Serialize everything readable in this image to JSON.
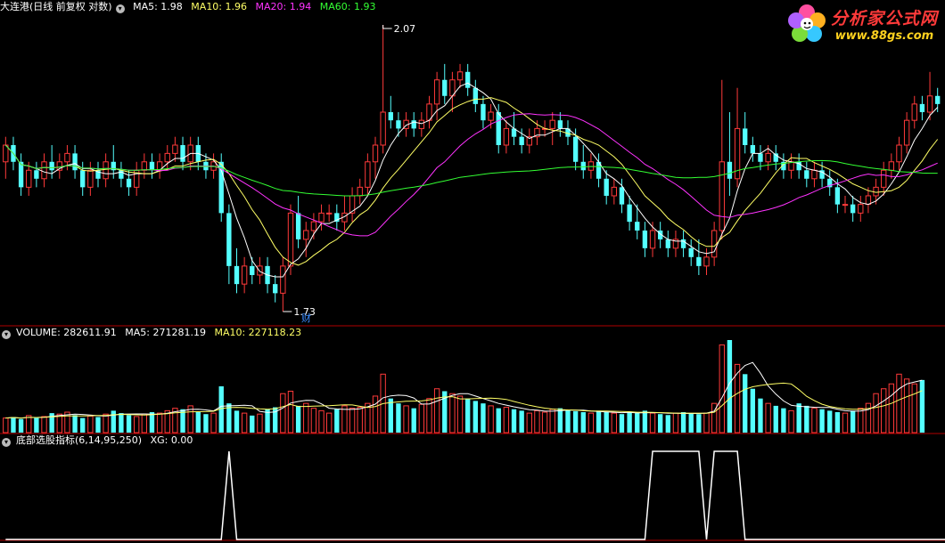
{
  "header_main": {
    "stock": "大连港(日线 前复权 对数)",
    "ma5": "MA5: 1.98",
    "ma10": "MA10: 1.96",
    "ma20": "MA20: 1.94",
    "ma60": "MA60: 1.93"
  },
  "header_volume": {
    "volume": "VOLUME: 282611.91",
    "ma5": "MA5: 271281.19",
    "ma10": "MA10: 227118.23"
  },
  "header_indicator": {
    "name": "底部选股指标(6,14,95,250)",
    "xg": "XG: 0.00"
  },
  "annotations": {
    "high_label": "2.07",
    "low_label": "1.73",
    "cai_label": "财"
  },
  "logo": {
    "line1": "分析家公式网",
    "line2": "www.88gs.com"
  },
  "colors": {
    "up": "#ff3a3a",
    "down": "#54ffff",
    "ma5": "#ffffff",
    "ma10": "#ffff66",
    "ma20": "#ff33ff",
    "ma60": "#33ff33",
    "separator": "#b00000"
  },
  "chart_data": {
    "type": "candlestick",
    "price_range": [
      1.73,
      2.07
    ],
    "candles_ohlc": [
      [
        1.9,
        1.93,
        1.88,
        1.92
      ],
      [
        1.92,
        1.93,
        1.89,
        1.9
      ],
      [
        1.9,
        1.91,
        1.86,
        1.87
      ],
      [
        1.87,
        1.9,
        1.86,
        1.89
      ],
      [
        1.89,
        1.9,
        1.87,
        1.88
      ],
      [
        1.88,
        1.91,
        1.87,
        1.9
      ],
      [
        1.9,
        1.92,
        1.88,
        1.89
      ],
      [
        1.89,
        1.91,
        1.88,
        1.9
      ],
      [
        1.9,
        1.92,
        1.89,
        1.91
      ],
      [
        1.91,
        1.92,
        1.88,
        1.89
      ],
      [
        1.89,
        1.9,
        1.86,
        1.87
      ],
      [
        1.87,
        1.9,
        1.86,
        1.89
      ],
      [
        1.89,
        1.9,
        1.87,
        1.88
      ],
      [
        1.88,
        1.91,
        1.87,
        1.9
      ],
      [
        1.9,
        1.92,
        1.88,
        1.89
      ],
      [
        1.89,
        1.9,
        1.87,
        1.88
      ],
      [
        1.88,
        1.89,
        1.86,
        1.87
      ],
      [
        1.87,
        1.9,
        1.86,
        1.89
      ],
      [
        1.89,
        1.91,
        1.88,
        1.9
      ],
      [
        1.9,
        1.91,
        1.88,
        1.89
      ],
      [
        1.89,
        1.91,
        1.88,
        1.9
      ],
      [
        1.9,
        1.92,
        1.89,
        1.91
      ],
      [
        1.91,
        1.93,
        1.9,
        1.92
      ],
      [
        1.92,
        1.93,
        1.89,
        1.9
      ],
      [
        1.9,
        1.93,
        1.89,
        1.92
      ],
      [
        1.92,
        1.93,
        1.89,
        1.9
      ],
      [
        1.9,
        1.91,
        1.88,
        1.89
      ],
      [
        1.89,
        1.91,
        1.88,
        1.9
      ],
      [
        1.9,
        1.91,
        1.83,
        1.84
      ],
      [
        1.84,
        1.85,
        1.76,
        1.78
      ],
      [
        1.78,
        1.8,
        1.75,
        1.76
      ],
      [
        1.76,
        1.79,
        1.75,
        1.78
      ],
      [
        1.78,
        1.79,
        1.76,
        1.77
      ],
      [
        1.77,
        1.79,
        1.76,
        1.78
      ],
      [
        1.78,
        1.79,
        1.75,
        1.76
      ],
      [
        1.76,
        1.77,
        1.74,
        1.75
      ],
      [
        1.75,
        1.79,
        1.73,
        1.78
      ],
      [
        1.78,
        1.85,
        1.77,
        1.84
      ],
      [
        1.84,
        1.86,
        1.8,
        1.81
      ],
      [
        1.81,
        1.83,
        1.79,
        1.82
      ],
      [
        1.82,
        1.84,
        1.81,
        1.83
      ],
      [
        1.83,
        1.85,
        1.82,
        1.84
      ],
      [
        1.84,
        1.85,
        1.83,
        1.84
      ],
      [
        1.84,
        1.85,
        1.82,
        1.83
      ],
      [
        1.83,
        1.86,
        1.82,
        1.84
      ],
      [
        1.84,
        1.87,
        1.83,
        1.86
      ],
      [
        1.86,
        1.88,
        1.85,
        1.87
      ],
      [
        1.87,
        1.91,
        1.86,
        1.9
      ],
      [
        1.9,
        1.93,
        1.88,
        1.92
      ],
      [
        1.92,
        2.07,
        1.91,
        1.96
      ],
      [
        1.96,
        1.98,
        1.94,
        1.95
      ],
      [
        1.95,
        1.96,
        1.93,
        1.94
      ],
      [
        1.94,
        1.96,
        1.93,
        1.95
      ],
      [
        1.95,
        1.96,
        1.93,
        1.94
      ],
      [
        1.94,
        1.96,
        1.93,
        1.95
      ],
      [
        1.95,
        1.98,
        1.94,
        1.97
      ],
      [
        1.97,
        2.01,
        1.95,
        2.0
      ],
      [
        2.0,
        2.02,
        1.97,
        1.98
      ],
      [
        1.98,
        2.01,
        1.96,
        2.0
      ],
      [
        2.0,
        2.02,
        1.99,
        2.01
      ],
      [
        2.01,
        2.02,
        1.98,
        1.99
      ],
      [
        1.99,
        2.0,
        1.96,
        1.97
      ],
      [
        1.97,
        1.98,
        1.94,
        1.95
      ],
      [
        1.95,
        1.97,
        1.94,
        1.96
      ],
      [
        1.96,
        1.97,
        1.91,
        1.92
      ],
      [
        1.92,
        1.95,
        1.91,
        1.94
      ],
      [
        1.94,
        1.96,
        1.92,
        1.93
      ],
      [
        1.93,
        1.94,
        1.91,
        1.92
      ],
      [
        1.92,
        1.94,
        1.91,
        1.93
      ],
      [
        1.93,
        1.95,
        1.92,
        1.94
      ],
      [
        1.94,
        1.95,
        1.93,
        1.94
      ],
      [
        1.94,
        1.96,
        1.92,
        1.95
      ],
      [
        1.95,
        1.96,
        1.93,
        1.94
      ],
      [
        1.94,
        1.95,
        1.92,
        1.93
      ],
      [
        1.93,
        1.94,
        1.89,
        1.9
      ],
      [
        1.9,
        1.92,
        1.88,
        1.89
      ],
      [
        1.89,
        1.91,
        1.88,
        1.9
      ],
      [
        1.9,
        1.91,
        1.87,
        1.88
      ],
      [
        1.88,
        1.89,
        1.85,
        1.86
      ],
      [
        1.86,
        1.88,
        1.85,
        1.87
      ],
      [
        1.87,
        1.88,
        1.84,
        1.85
      ],
      [
        1.85,
        1.86,
        1.82,
        1.83
      ],
      [
        1.83,
        1.85,
        1.81,
        1.82
      ],
      [
        1.82,
        1.83,
        1.79,
        1.8
      ],
      [
        1.8,
        1.83,
        1.79,
        1.82
      ],
      [
        1.82,
        1.83,
        1.8,
        1.81
      ],
      [
        1.81,
        1.82,
        1.79,
        1.8
      ],
      [
        1.8,
        1.82,
        1.79,
        1.81
      ],
      [
        1.81,
        1.82,
        1.79,
        1.8
      ],
      [
        1.8,
        1.81,
        1.78,
        1.79
      ],
      [
        1.79,
        1.81,
        1.77,
        1.78
      ],
      [
        1.78,
        1.8,
        1.77,
        1.79
      ],
      [
        1.79,
        1.83,
        1.78,
        1.82
      ],
      [
        1.82,
        2.0,
        1.81,
        1.9
      ],
      [
        1.9,
        1.96,
        1.86,
        1.88
      ],
      [
        1.88,
        1.99,
        1.87,
        1.94
      ],
      [
        1.94,
        1.96,
        1.91,
        1.92
      ],
      [
        1.92,
        1.93,
        1.9,
        1.91
      ],
      [
        1.91,
        1.92,
        1.89,
        1.9
      ],
      [
        1.9,
        1.92,
        1.89,
        1.91
      ],
      [
        1.91,
        1.92,
        1.89,
        1.9
      ],
      [
        1.9,
        1.91,
        1.88,
        1.89
      ],
      [
        1.89,
        1.91,
        1.88,
        1.9
      ],
      [
        1.9,
        1.91,
        1.88,
        1.89
      ],
      [
        1.89,
        1.9,
        1.87,
        1.88
      ],
      [
        1.88,
        1.9,
        1.87,
        1.89
      ],
      [
        1.89,
        1.9,
        1.87,
        1.88
      ],
      [
        1.88,
        1.89,
        1.86,
        1.87
      ],
      [
        1.87,
        1.88,
        1.84,
        1.85
      ],
      [
        1.85,
        1.86,
        1.84,
        1.85
      ],
      [
        1.85,
        1.86,
        1.83,
        1.84
      ],
      [
        1.84,
        1.86,
        1.83,
        1.85
      ],
      [
        1.85,
        1.87,
        1.84,
        1.86
      ],
      [
        1.86,
        1.88,
        1.85,
        1.87
      ],
      [
        1.87,
        1.9,
        1.86,
        1.89
      ],
      [
        1.89,
        1.91,
        1.88,
        1.9
      ],
      [
        1.9,
        1.93,
        1.89,
        1.92
      ],
      [
        1.92,
        1.96,
        1.91,
        1.95
      ],
      [
        1.95,
        1.98,
        1.94,
        1.97
      ],
      [
        1.97,
        1.98,
        1.95,
        1.96
      ],
      [
        1.96,
        2.01,
        1.95,
        1.98
      ],
      [
        1.98,
        1.99,
        1.96,
        1.97
      ]
    ],
    "volume_panel": {
      "values": [
        30,
        32,
        28,
        35,
        30,
        33,
        40,
        38,
        42,
        36,
        30,
        34,
        32,
        38,
        45,
        40,
        36,
        33,
        38,
        42,
        40,
        45,
        50,
        48,
        55,
        42,
        38,
        40,
        95,
        60,
        45,
        40,
        35,
        38,
        48,
        52,
        80,
        85,
        55,
        60,
        50,
        45,
        40,
        48,
        55,
        50,
        52,
        60,
        75,
        120,
        70,
        60,
        55,
        50,
        58,
        70,
        90,
        85,
        80,
        75,
        70,
        65,
        60,
        55,
        50,
        52,
        48,
        45,
        40,
        45,
        42,
        48,
        50,
        46,
        44,
        42,
        40,
        45,
        42,
        40,
        38,
        42,
        40,
        45,
        40,
        38,
        36,
        40,
        42,
        40,
        38,
        40,
        60,
        180,
        190,
        140,
        120,
        90,
        70,
        60,
        55,
        50,
        45,
        60,
        55,
        50,
        48,
        45,
        42,
        40,
        45,
        50,
        60,
        80,
        90,
        100,
        120,
        110,
        100,
        108
      ]
    },
    "indicator_panel": {
      "name": "底部选股指标(6,14,95,250)",
      "signal": [
        0,
        0,
        0,
        0,
        0,
        0,
        0,
        0,
        0,
        0,
        0,
        0,
        0,
        0,
        0,
        0,
        0,
        0,
        0,
        0,
        0,
        0,
        0,
        0,
        0,
        0,
        0,
        0,
        0,
        1,
        0,
        0,
        0,
        0,
        0,
        0,
        0,
        0,
        0,
        0,
        0,
        0,
        0,
        0,
        0,
        0,
        0,
        0,
        0,
        0,
        0,
        0,
        0,
        0,
        0,
        0,
        0,
        0,
        0,
        0,
        0,
        0,
        0,
        0,
        0,
        0,
        0,
        0,
        0,
        0,
        0,
        0,
        0,
        0,
        0,
        0,
        0,
        0,
        0,
        0,
        0,
        0,
        0,
        0,
        1,
        1,
        1,
        1,
        1,
        1,
        1,
        0,
        1,
        1,
        1,
        1,
        0,
        0,
        0,
        0,
        0,
        0,
        0,
        0,
        0,
        0,
        0,
        0,
        0,
        0,
        0,
        0,
        0,
        0,
        0,
        0,
        0,
        0,
        0,
        0,
        0,
        0,
        0,
        0,
        0,
        0,
        0
      ]
    }
  }
}
